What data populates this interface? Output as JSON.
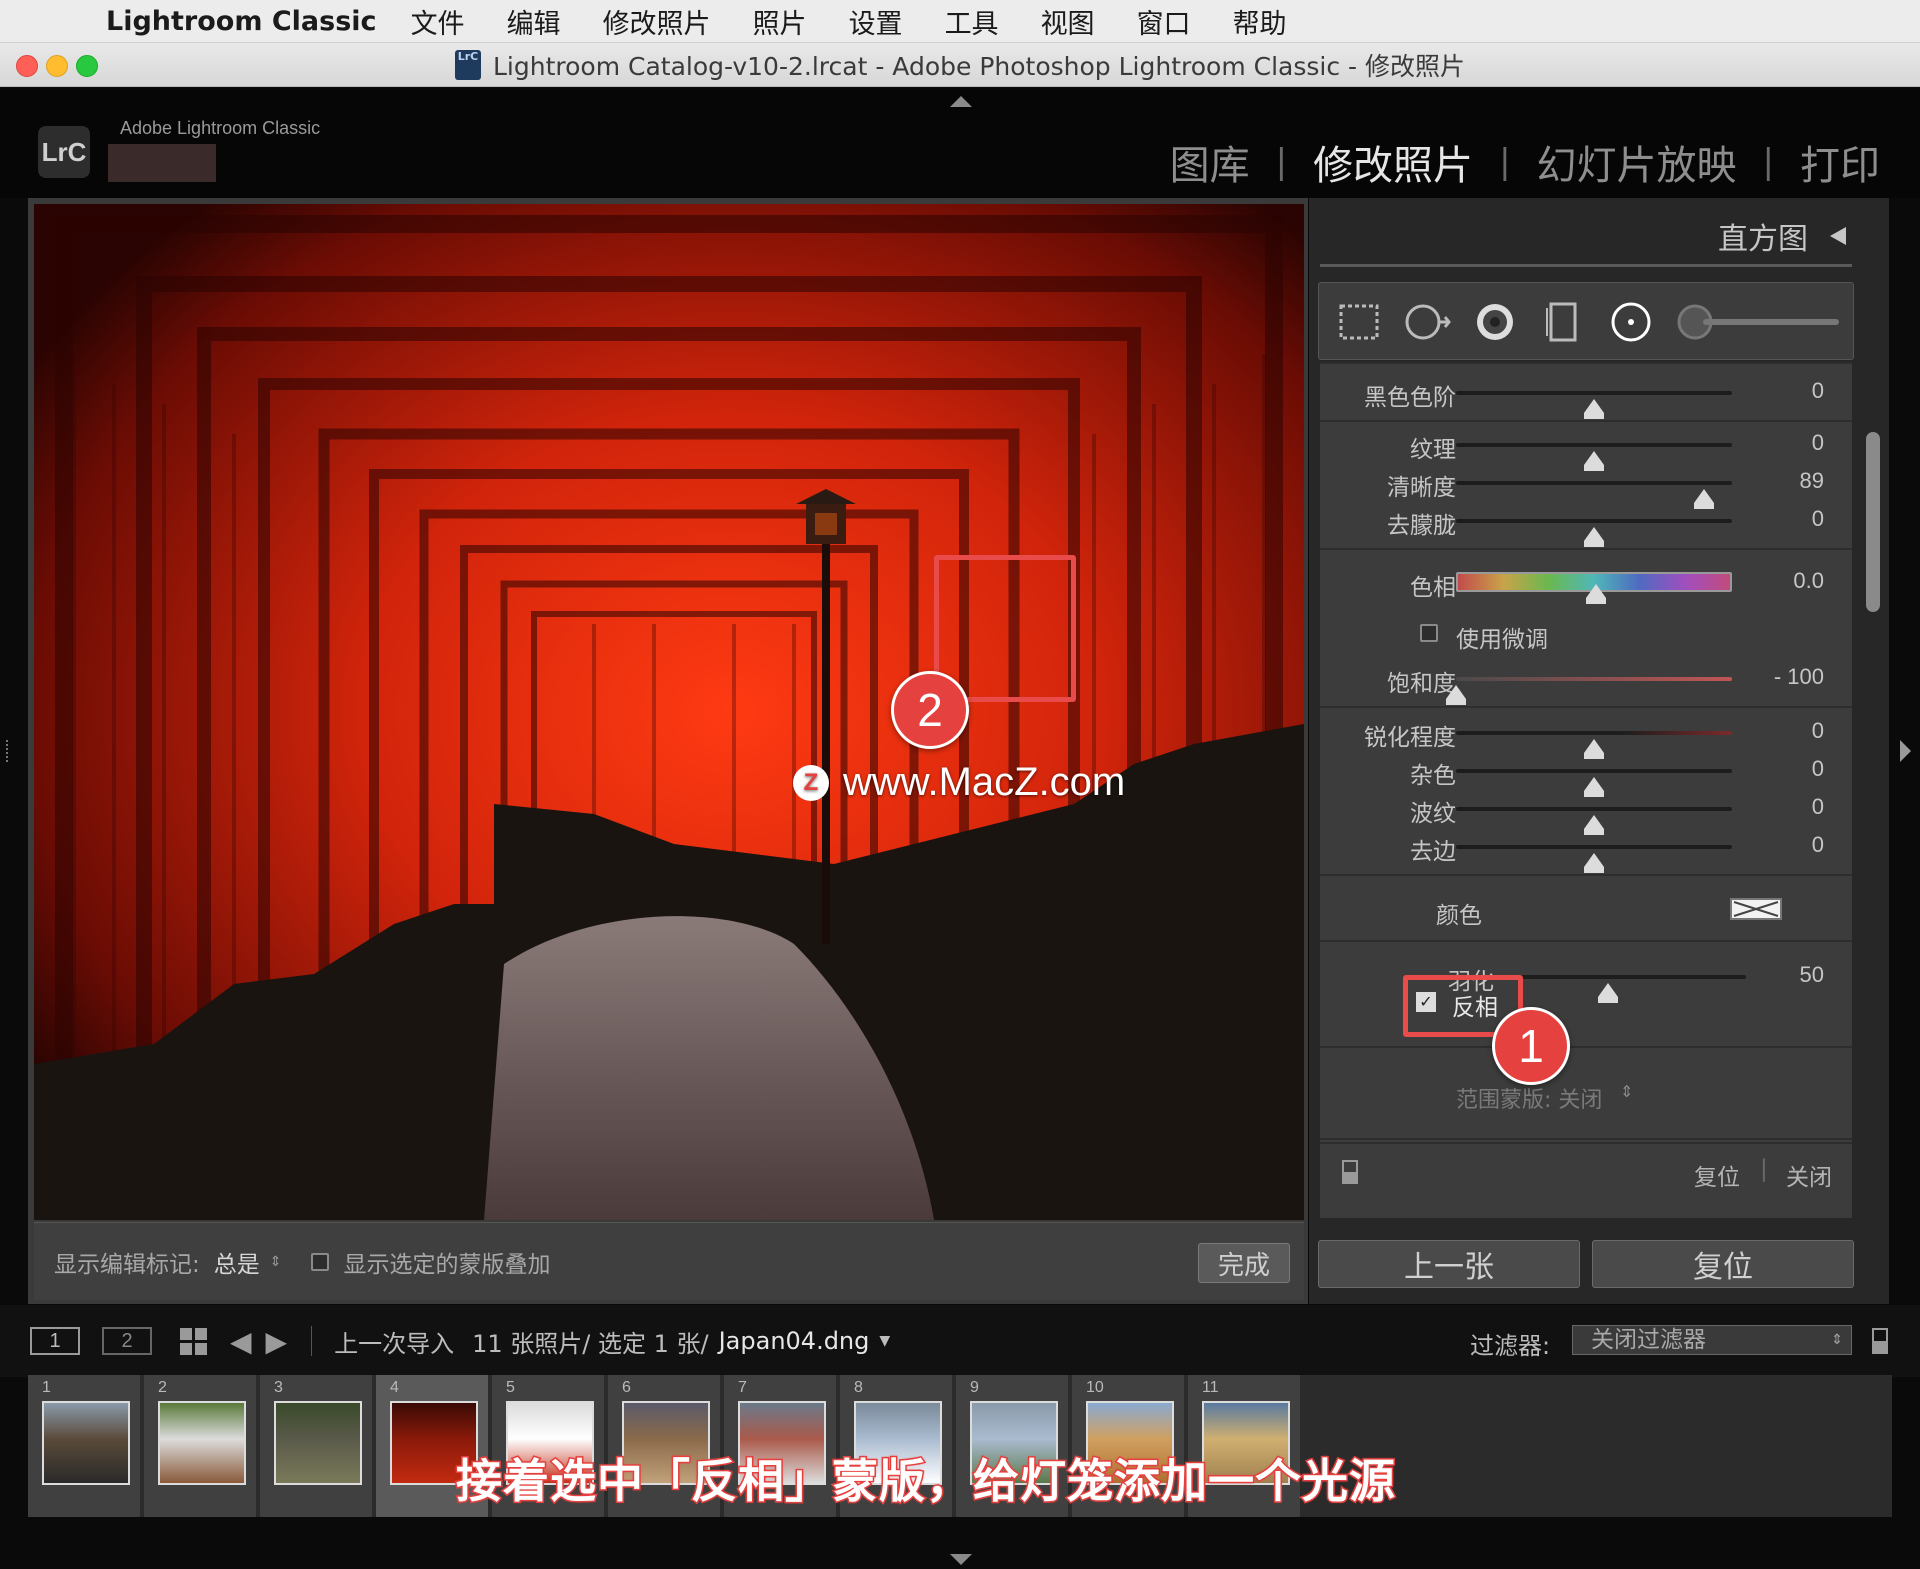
{
  "menubar": {
    "app_name": "Lightroom Classic",
    "items": [
      "文件",
      "编辑",
      "修改照片",
      "照片",
      "设置",
      "工具",
      "视图",
      "窗口",
      "帮助"
    ]
  },
  "window": {
    "title": "Lightroom Catalog-v10-2.lrcat - Adobe Photoshop Lightroom Classic - 修改照片",
    "doc_icon_label": "LrC"
  },
  "header": {
    "logo": "LrC",
    "brand": "Adobe Lightroom Classic",
    "modules": [
      "图库",
      "修改照片",
      "幻灯片放映",
      "打印"
    ],
    "active_module": "修改照片"
  },
  "photo": {
    "watermark": "www.MacZ.com",
    "watermark_icon": "Z",
    "annotation_2": "2"
  },
  "toolbar": {
    "show_edit_pins_label": "显示编辑标记:",
    "show_edit_pins_value": "总是",
    "show_mask_overlay_label": "显示选定的蒙版叠加",
    "done_label": "完成"
  },
  "right_panel": {
    "histogram_label": "直方图",
    "rows": {
      "blacks": {
        "label": "黑色色阶",
        "value": "0",
        "pos": 0.5
      },
      "texture": {
        "label": "纹理",
        "value": "0",
        "pos": 0.5
      },
      "clarity": {
        "label": "清晰度",
        "value": "89",
        "pos": 0.9
      },
      "dehaze": {
        "label": "去朦胧",
        "value": "0",
        "pos": 0.5
      },
      "hue": {
        "label": "色相",
        "value": "0.0",
        "pos": 0.5
      },
      "fine_adjust": {
        "label": "使用微调"
      },
      "saturation": {
        "label": "饱和度",
        "value": "- 100",
        "pos": 0.0
      },
      "sharpness": {
        "label": "锐化程度",
        "value": "0",
        "pos": 0.5
      },
      "noise": {
        "label": "杂色",
        "value": "0",
        "pos": 0.5
      },
      "moire": {
        "label": "波纹",
        "value": "0",
        "pos": 0.5
      },
      "defringe": {
        "label": "去边",
        "value": "0",
        "pos": 0.5
      },
      "color": {
        "label": "颜色"
      },
      "feather": {
        "label": "羽化",
        "value": "50",
        "pos": 0.5
      },
      "invert": {
        "label": "反相",
        "checked": true
      },
      "range_mask": {
        "label": "范围蒙版: 关闭"
      }
    },
    "annotation_1": "1",
    "footer": {
      "reset": "复位",
      "close": "关闭"
    },
    "buttons": {
      "previous": "上一张",
      "reset": "复位"
    }
  },
  "filmstrip_header": {
    "view1": "1",
    "view2": "2",
    "source": "上一次导入",
    "count": "11 张照片/ 选定 1 张/",
    "filename": "Japan04.dng",
    "filter_label": "过滤器:",
    "filter_value": "关闭过滤器"
  },
  "filmstrip": {
    "selected_index": 4,
    "cells": [
      {
        "n": "1",
        "colors": [
          "#5a4a3a",
          "#2a2a2a",
          "#8a9aaa"
        ]
      },
      {
        "n": "2",
        "colors": [
          "#dcdcdc",
          "#8a5a3a",
          "#5a7a3a"
        ]
      },
      {
        "n": "3",
        "colors": [
          "#5a5a4a",
          "#7a7a5a",
          "#3a4a2a"
        ]
      },
      {
        "n": "4",
        "colors": [
          "#8a1a0a",
          "#c22a10",
          "#3a0a05"
        ]
      },
      {
        "n": "5",
        "colors": [
          "#ffffff",
          "#c2301a",
          "#dcdcdc"
        ]
      },
      {
        "n": "6",
        "colors": [
          "#8a6a4a",
          "#c2a27a",
          "#5a5a6a"
        ]
      },
      {
        "n": "7",
        "colors": [
          "#aa5a4a",
          "#dcdcdc",
          "#6a7a8a"
        ]
      },
      {
        "n": "8",
        "colors": [
          "#aabbd0",
          "#ffffff",
          "#7a8a9a"
        ]
      },
      {
        "n": "9",
        "colors": [
          "#aabbd0",
          "#5a7a4a",
          "#8a9aaa"
        ]
      },
      {
        "n": "10",
        "colors": [
          "#d0a060",
          "#b07030",
          "#8aaad0"
        ]
      },
      {
        "n": "11",
        "colors": [
          "#d0b070",
          "#a08050",
          "#5a7aa0"
        ]
      }
    ]
  },
  "caption": "接着选中「反相」蒙版，给灯笼添加一个光源",
  "colors": {
    "accent_red": "#e5413f",
    "panel_bg": "#3c3c3c",
    "torii_red": "#c22a10"
  }
}
